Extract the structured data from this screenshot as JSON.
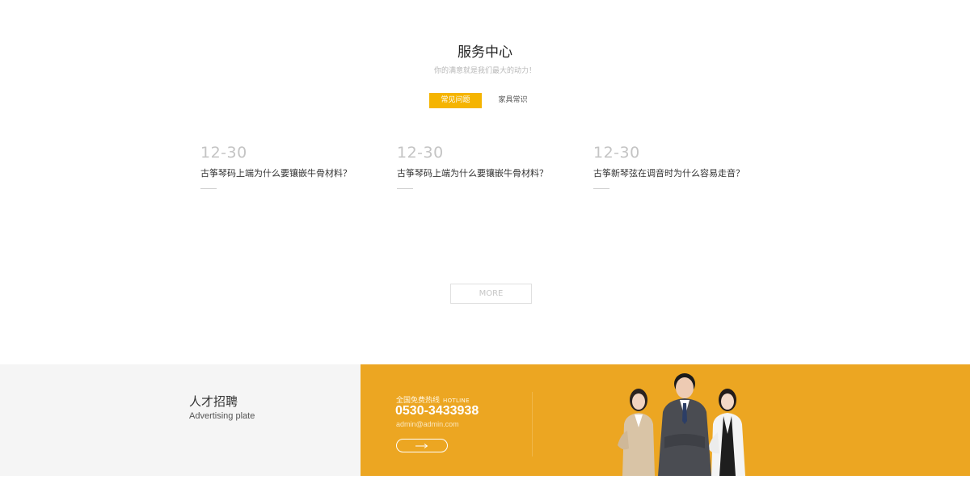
{
  "service": {
    "title": "服务中心",
    "subtitle": "你的满意就是我们最大的动力！",
    "tabs": [
      {
        "label": "常见问题",
        "active": true
      },
      {
        "label": "家具常识",
        "active": false
      }
    ],
    "items": [
      {
        "date": "12-30",
        "question": "古筝琴码上端为什么要镶嵌牛骨材料？"
      },
      {
        "date": "12-30",
        "question": "古筝琴码上端为什么要镶嵌牛骨材料？"
      },
      {
        "date": "12-30",
        "question": "古筝新琴弦在调音时为什么容易走音？"
      }
    ],
    "more_label": "MORE"
  },
  "recruit": {
    "title": "人才招聘",
    "subtitle": "Advertising plate"
  },
  "contact": {
    "hotline_label": "全国免费热线",
    "hotline_en": "HOTLINE",
    "phone": "0530-3433938",
    "email": "admin@admin.com"
  },
  "colors": {
    "accent": "#f5b400",
    "band": "#eca622",
    "band_left": "#f5f5f5"
  },
  "icons": {
    "arrow": "arrow-right-icon",
    "people": "business-team-illustration"
  }
}
